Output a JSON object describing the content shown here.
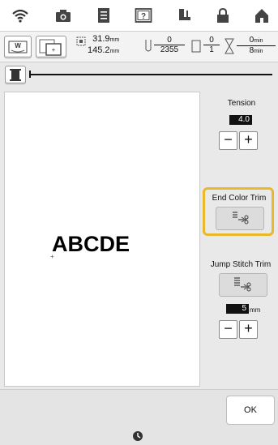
{
  "topbar": {
    "icons": [
      "wifi-icon",
      "camera-icon",
      "document-icon",
      "help-icon",
      "presser-foot-icon",
      "lock-icon",
      "house-icon"
    ]
  },
  "info": {
    "width_value": "31.9",
    "width_unit": "mm",
    "height_value": "145.2",
    "height_unit": "mm",
    "stitch_count": "0",
    "stitch_total": "2355",
    "color_count": "0",
    "color_total": "1",
    "time_value": "0",
    "time_unit": "min",
    "time_total": "8",
    "time_total_unit": "min",
    "thread_thumb_label": "W"
  },
  "preview": {
    "text": "ABCDE"
  },
  "settings": {
    "tension_label": "Tension",
    "tension_value": "4.0",
    "end_color_trim_label": "End Color Trim",
    "jump_stitch_trim_label": "Jump Stitch Trim",
    "jump_value": "5",
    "jump_unit": "mm",
    "highlight_color": "#e9b82b"
  },
  "footer": {
    "ok_label": "OK"
  }
}
